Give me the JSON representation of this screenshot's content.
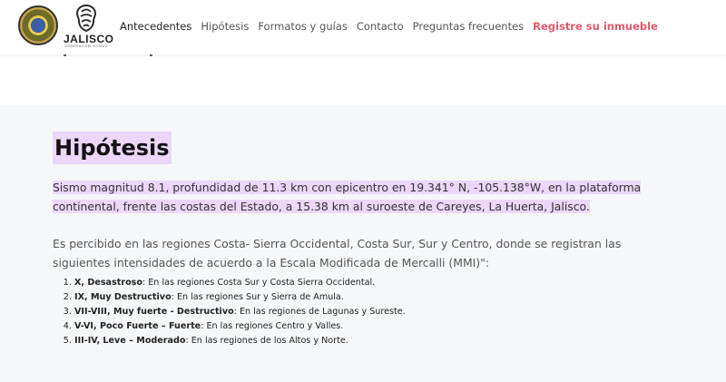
{
  "nav": {
    "logo_text": "JALISCO",
    "logo_sub": "GOBIERNO DEL ESTADO",
    "links": [
      {
        "label": "Antecedentes"
      },
      {
        "label": "Hipótesis"
      },
      {
        "label": "Formatos y guías"
      },
      {
        "label": "Contacto"
      },
      {
        "label": "Preguntas frecuentes"
      },
      {
        "label": "Registre su inmueble"
      }
    ]
  },
  "colors": {
    "accent": "#e05a6b",
    "highlight": "#ecd7fb",
    "content_bg": "#f6f7f9"
  },
  "main": {
    "title": "Hipótesis",
    "paragraph1": "Sismo magnitud 8.1, profundidad de 11.3 km con epicentro en 19.341° N, -105.138°W, en la plataforma continental, frente las costas del Estado, a 15.38 km al suroeste de Careyes, La Huerta, Jalisco.",
    "paragraph2": "Es percibido en las regiones Costa- Sierra Occidental, Costa Sur, Sur y Centro, donde se registran las siguientes intensidades de acuerdo a la Escala Modificada de Mercalli (MMI)\":",
    "intensities": [
      {
        "level": "X, Desastroso",
        "text": ": En las regiones Costa Sur y Costa Sierra Occidental."
      },
      {
        "level": "IX, Muy Destructivo",
        "text": ": En las regiones Sur y Sierra de Amula."
      },
      {
        "level": "VII-VIII, Muy fuerte - Destructivo",
        "text": ": En las regiones de Lagunas y Sureste."
      },
      {
        "level": "V-VI, Poco Fuerte – Fuerte",
        "text": ": En las regiones Centro y Valles."
      },
      {
        "level": "III-IV, Leve – Moderado",
        "text": ": En las regiones de los Altos y Norte."
      }
    ]
  }
}
